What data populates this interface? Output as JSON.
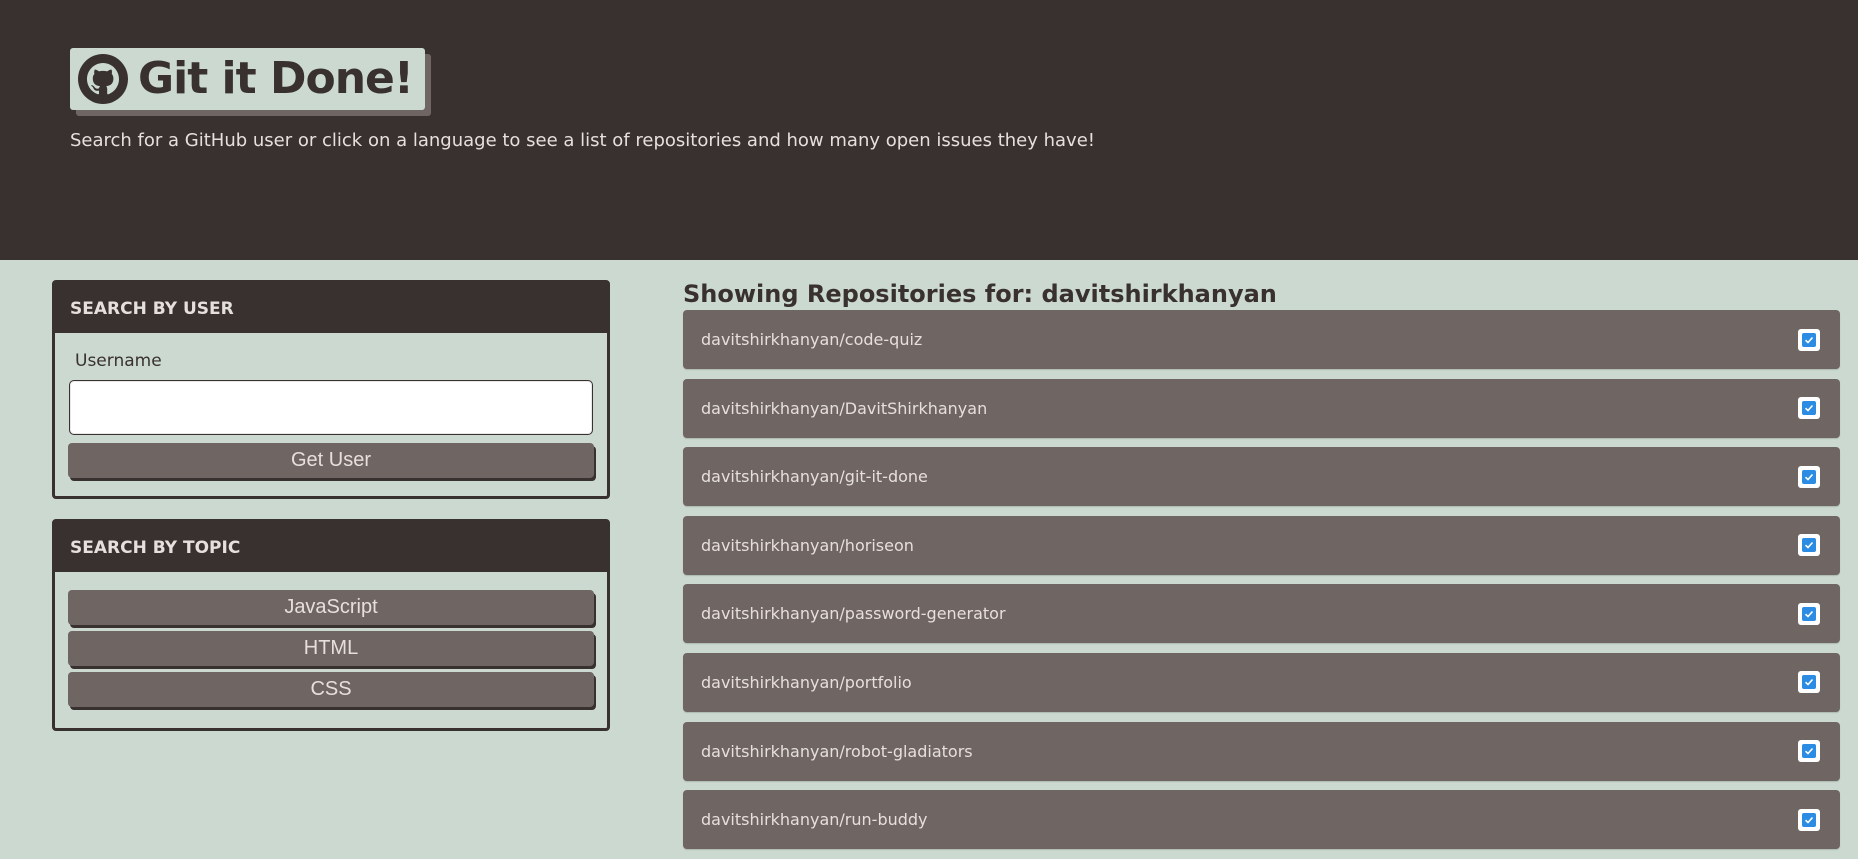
{
  "header": {
    "logo_icon": "github-octocat-icon",
    "title": "Git it Done!",
    "tagline": "Search for a GitHub user or click on a language to see a list of repositories and how many open issues they have!"
  },
  "search_user": {
    "title": "SEARCH BY USER",
    "username_label": "Username",
    "username_value": "",
    "button_label": "Get User"
  },
  "search_topic": {
    "title": "SEARCH BY TOPIC",
    "topics": [
      "JavaScript",
      "HTML",
      "CSS"
    ]
  },
  "repos": {
    "heading_prefix": "Showing Repositories for: ",
    "user": "davitshirkhanyan",
    "items": [
      {
        "name": "davitshirkhanyan/code-quiz",
        "status_icon": "check-square-icon"
      },
      {
        "name": "davitshirkhanyan/DavitShirkhanyan",
        "status_icon": "check-square-icon"
      },
      {
        "name": "davitshirkhanyan/git-it-done",
        "status_icon": "check-square-icon"
      },
      {
        "name": "davitshirkhanyan/horiseon",
        "status_icon": "check-square-icon"
      },
      {
        "name": "davitshirkhanyan/password-generator",
        "status_icon": "check-square-icon"
      },
      {
        "name": "davitshirkhanyan/portfolio",
        "status_icon": "check-square-icon"
      },
      {
        "name": "davitshirkhanyan/robot-gladiators",
        "status_icon": "check-square-icon"
      },
      {
        "name": "davitshirkhanyan/run-buddy",
        "status_icon": "check-square-icon"
      }
    ]
  },
  "colors": {
    "dark": "#393030",
    "background": "#cbd9d0",
    "button": "#6f6563",
    "light_text": "#e6e0dc",
    "check_accent": "#2c8be3"
  }
}
